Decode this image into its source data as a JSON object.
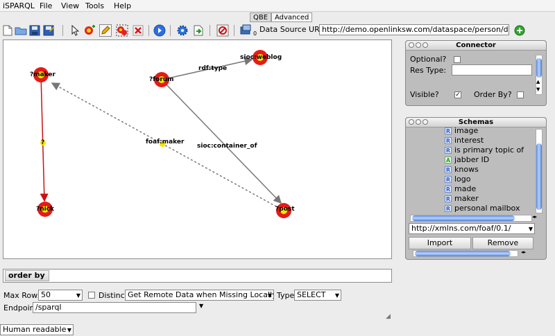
{
  "menu": [
    "iSPARQL",
    "File",
    "View",
    "Tools",
    "Help"
  ],
  "tabs": [
    "QBE",
    "Advanced"
  ],
  "toolbar": {
    "datasource_index": "0",
    "datasource_label": "Data Source URI",
    "datasource_value": "http://demo.openlinksw.com/dataspace/person/dem"
  },
  "graph": {
    "nodes": [
      "?maker",
      "?forum",
      "sioc:weblog",
      "?",
      "foaf:maker",
      "?nick",
      "?post"
    ],
    "edges": [
      "rdf:type",
      "sioc:container_of"
    ]
  },
  "connector": {
    "title": "Connector",
    "optional_label": "Optional?",
    "res_type_label": "Res Type:",
    "visible_label": "Visible?",
    "visible_mark": "✓",
    "orderby_label": "Order By?"
  },
  "schemas": {
    "title": "Schemas",
    "items": [
      {
        "label": "image",
        "badge": "R"
      },
      {
        "label": "interest",
        "badge": "R"
      },
      {
        "label": "is primary topic of",
        "badge": "R"
      },
      {
        "label": "jabber ID",
        "badge": "A"
      },
      {
        "label": "knows",
        "badge": "R"
      },
      {
        "label": "logo",
        "badge": "R"
      },
      {
        "label": "made",
        "badge": "R"
      },
      {
        "label": "maker",
        "badge": "R"
      },
      {
        "label": "personal mailbox",
        "badge": "R"
      }
    ],
    "uri_value": "http://xmlns.com/foaf/0.1/",
    "import_label": "Import",
    "remove_label": "Remove"
  },
  "bottom": {
    "order_by_label": "order by",
    "max_rows_label": "Max Rows",
    "max_rows_value": "50",
    "distinct_label": "Distinct",
    "remote_value": "Get Remote Data when Missing Locally",
    "type_label": "Type",
    "type_value": "SELECT",
    "endpoint_label": "Endpoint",
    "endpoint_value": "/sparql",
    "format_value": "Human readable"
  }
}
